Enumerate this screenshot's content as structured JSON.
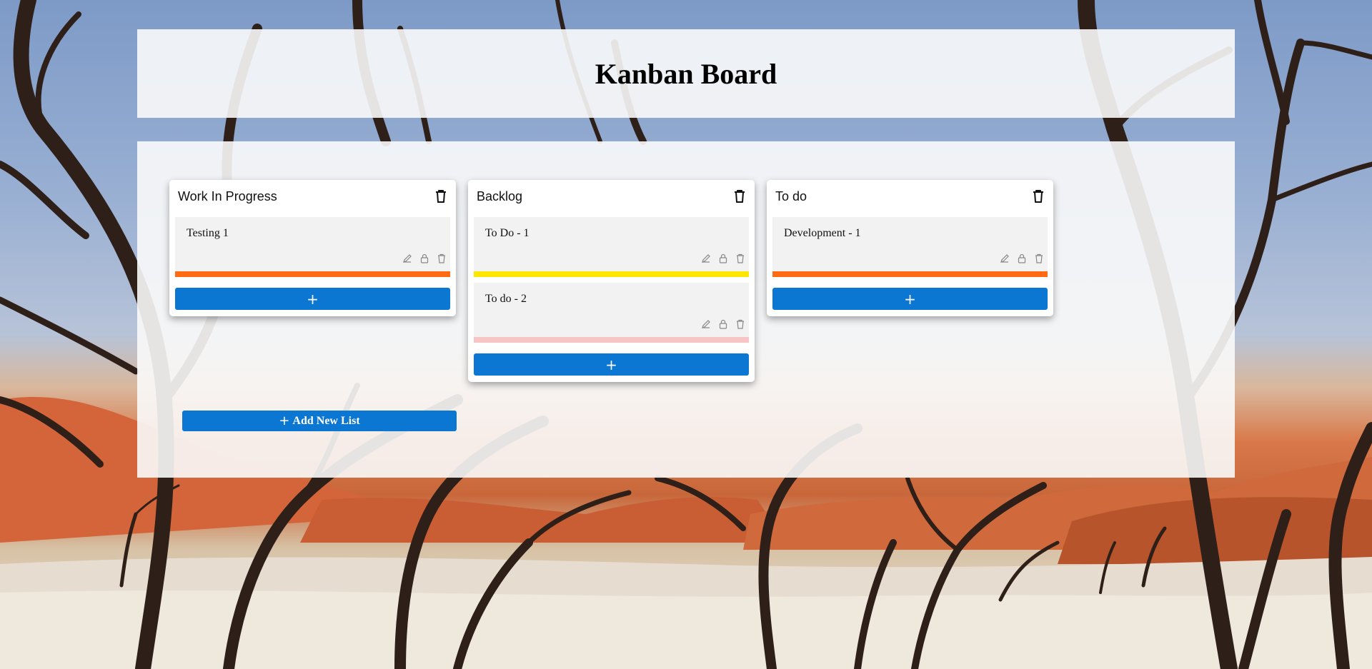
{
  "page": {
    "title": "Kanban Board"
  },
  "lists": [
    {
      "title": "Work In Progress",
      "cards": [
        {
          "text": "Testing 1",
          "color": "#ff6a13"
        }
      ]
    },
    {
      "title": "Backlog",
      "cards": [
        {
          "text": "To Do - 1",
          "color": "#ffe600"
        },
        {
          "text": "To do - 2",
          "color": "#f7c6c4"
        }
      ]
    },
    {
      "title": "To do",
      "cards": [
        {
          "text": "Development - 1",
          "color": "#ff6a13"
        }
      ]
    }
  ],
  "buttons": {
    "add_card_symbol": "+",
    "add_list_label": "Add New List"
  },
  "icons": {
    "list_delete": "trash-icon",
    "card_edit": "pencil-icon",
    "card_lock": "lock-icon",
    "card_delete": "trash-icon",
    "add": "plus-icon"
  },
  "colors": {
    "accent": "#0b77d2",
    "panel": "#fafafa"
  }
}
